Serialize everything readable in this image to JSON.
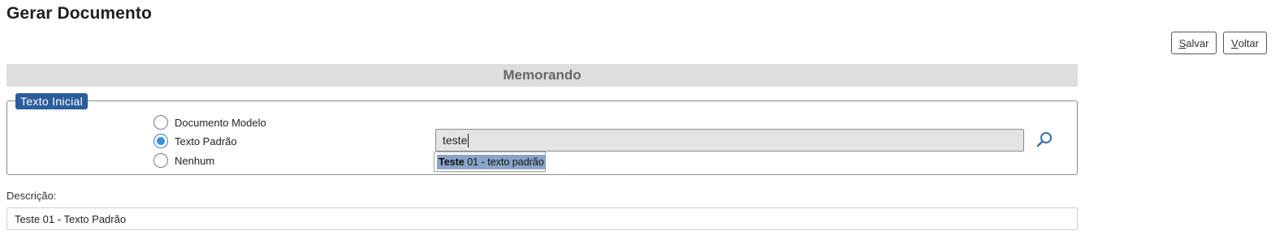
{
  "page": {
    "title": "Gerar Documento"
  },
  "toolbar": {
    "save": {
      "accel": "S",
      "rest": "alvar"
    },
    "back": {
      "accel": "V",
      "rest": "oltar"
    }
  },
  "section": {
    "title": "Memorando"
  },
  "texto_inicial": {
    "legend": "Texto Inicial",
    "options": [
      {
        "label": "Documento Modelo",
        "checked": false
      },
      {
        "label": "Texto Padrão",
        "checked": true
      },
      {
        "label": "Nenhum",
        "checked": false
      }
    ],
    "search": {
      "value": "teste"
    },
    "autocomplete": {
      "match": "Teste",
      "rest": " 01 - texto padrão"
    }
  },
  "descricao": {
    "label": "Descrição:",
    "value": "Teste 01 - Texto Padrão"
  },
  "icons": {
    "search": "search-icon"
  },
  "colors": {
    "legend_bg": "#2b5d9c",
    "radio_checked": "#3a8fd9",
    "highlight": "#8aa4c8"
  }
}
